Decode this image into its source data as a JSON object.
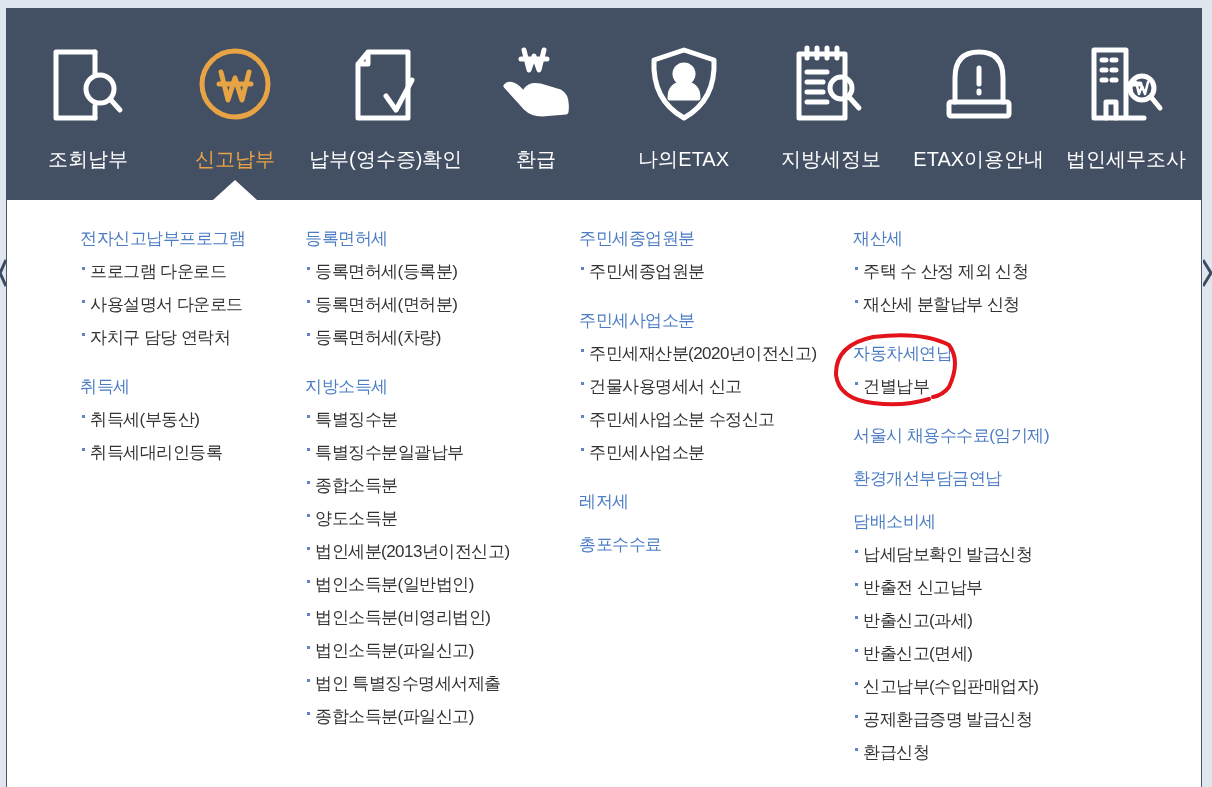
{
  "nav": [
    {
      "label": "조회납부",
      "kind": "search-doc",
      "selected": false
    },
    {
      "label": "신고납부",
      "kind": "won-coin",
      "selected": true
    },
    {
      "label": "납부(영수증)확인",
      "kind": "check-doc",
      "selected": false
    },
    {
      "label": "환급",
      "kind": "won-hand",
      "selected": false
    },
    {
      "label": "나의ETAX",
      "kind": "shield-user",
      "selected": false
    },
    {
      "label": "지방세정보",
      "kind": "notepad-search",
      "selected": false
    },
    {
      "label": "ETAX이용안내",
      "kind": "alarm",
      "selected": false
    },
    {
      "label": "법인세무조사",
      "kind": "building-search",
      "selected": false
    }
  ],
  "columns": [
    [
      {
        "heading": "전자신고납부프로그램",
        "items": [
          "프로그램 다운로드",
          "사용설명서 다운로드",
          "자치구 담당 연락처"
        ]
      },
      {
        "heading": "취득세",
        "items": [
          "취득세(부동산)",
          "취득세대리인등록"
        ]
      }
    ],
    [
      {
        "heading": "등록면허세",
        "items": [
          "등록면허세(등록분)",
          "등록면허세(면허분)",
          "등록면허세(차량)"
        ]
      },
      {
        "heading": "지방소득세",
        "items": [
          "특별징수분",
          "특별징수분일괄납부",
          "종합소득분",
          "양도소득분",
          "법인세분(2013년이전신고)",
          "법인소득분(일반법인)",
          "법인소득분(비영리법인)",
          "법인소득분(파일신고)",
          "법인 특별징수명세서제출",
          "종합소득분(파일신고)"
        ]
      }
    ],
    [
      {
        "heading": "주민세종업원분",
        "items": [
          "주민세종업원분"
        ]
      },
      {
        "heading": "주민세사업소분",
        "items": [
          "주민세재산분(2020년이전신고)",
          "건물사용명세서 신고",
          "주민세사업소분 수정신고",
          "주민세사업소분"
        ]
      },
      {
        "heading": "레저세"
      },
      {
        "heading": "총포수수료"
      }
    ],
    [
      {
        "heading": "재산세",
        "items": [
          "주택 수 산정 제외 신청",
          "재산세 분할납부 신청"
        ]
      },
      {
        "heading": "자동차세연납",
        "items": [
          "건별납부"
        ],
        "circled": true
      },
      {
        "heading": "서울시 채용수수료(임기제)"
      },
      {
        "heading": "환경개선부담금연납"
      },
      {
        "heading": "담배소비세",
        "items": [
          "납세담보확인 발급신청",
          "반출전 신고납부",
          "반출신고(과세)",
          "반출신고(면세)",
          "신고납부(수입판매업자)",
          "공제환급증명 발급신청",
          "환급신청"
        ]
      }
    ]
  ]
}
